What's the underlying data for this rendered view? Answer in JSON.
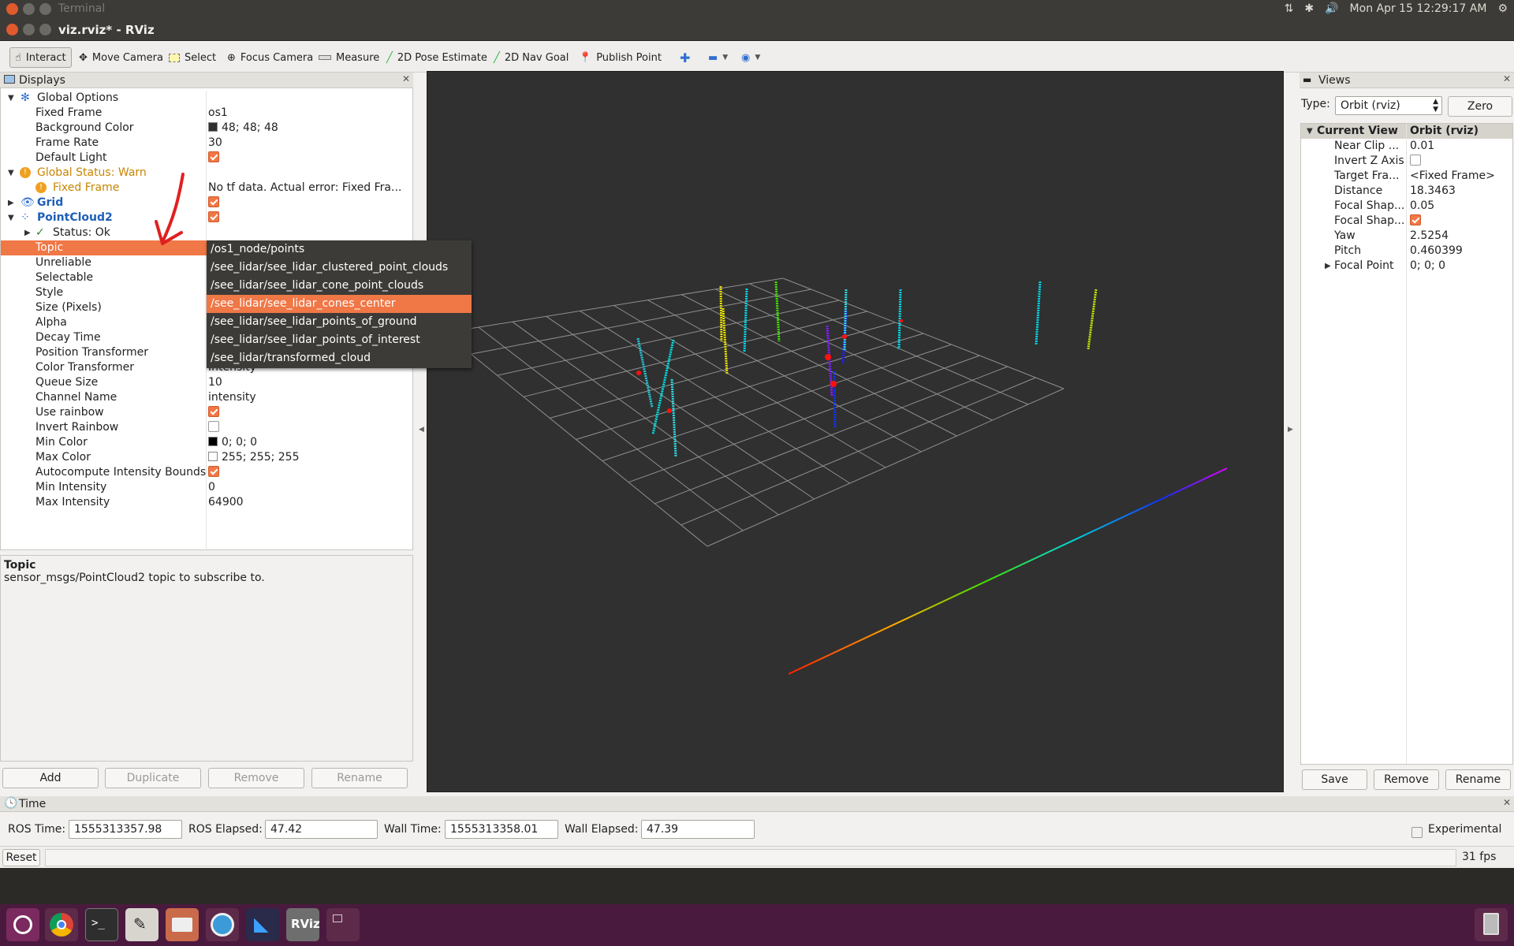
{
  "system_bar": {
    "title": "Terminal",
    "clock": "Mon Apr 15 12:29:17 AM"
  },
  "window": {
    "title": "viz.rviz* - RViz"
  },
  "toolbar": {
    "tools": [
      {
        "label": "Interact",
        "icon": "hand-icon"
      },
      {
        "label": "Move Camera",
        "icon": "move-camera-icon"
      },
      {
        "label": "Select",
        "icon": "select-icon"
      },
      {
        "label": "Focus Camera",
        "icon": "focus-camera-icon"
      },
      {
        "label": "Measure",
        "icon": "measure-icon"
      },
      {
        "label": "2D Pose Estimate",
        "icon": "pose-arrow-icon"
      },
      {
        "label": "2D Nav Goal",
        "icon": "nav-goal-icon"
      },
      {
        "label": "Publish Point",
        "icon": "pin-icon"
      }
    ]
  },
  "displays": {
    "title": "Displays",
    "rows": {
      "global_options": "Global Options",
      "fixed_frame": {
        "name": "Fixed Frame",
        "value": "os1"
      },
      "background_color": {
        "name": "Background Color",
        "value": "48; 48; 48",
        "swatch": "#303030"
      },
      "frame_rate": {
        "name": "Frame Rate",
        "value": "30"
      },
      "default_light": {
        "name": "Default Light"
      },
      "global_status": "Global Status: Warn",
      "fixed_frame_warn": {
        "name": "Fixed Frame",
        "value": "No tf data.  Actual error: Fixed Fra..."
      },
      "grid": "Grid",
      "pointcloud2": "PointCloud2",
      "status_ok": "Status: Ok",
      "topic": "Topic",
      "unreliable": "Unreliable",
      "selectable": "Selectable",
      "style": "Style",
      "size_pixels": "Size (Pixels)",
      "alpha": "Alpha",
      "decay_time": "Decay Time",
      "position_transformer": "Position Transformer",
      "color_transformer": {
        "name": "Color Transformer",
        "value": "Intensity"
      },
      "queue_size": {
        "name": "Queue Size",
        "value": "10"
      },
      "channel_name": {
        "name": "Channel Name",
        "value": "intensity"
      },
      "use_rainbow": {
        "name": "Use rainbow"
      },
      "invert_rainbow": {
        "name": "Invert Rainbow"
      },
      "min_color": {
        "name": "Min Color",
        "value": "0; 0; 0",
        "swatch": "#000000"
      },
      "max_color": {
        "name": "Max Color",
        "value": "255; 255; 255",
        "swatch": "#ffffff"
      },
      "autocompute": {
        "name": "Autocompute Intensity Bounds"
      },
      "min_intensity": {
        "name": "Min Intensity",
        "value": "0"
      },
      "max_intensity": {
        "name": "Max Intensity",
        "value": "64900"
      }
    },
    "topic_options": [
      "/os1_node/points",
      "/see_lidar/see_lidar_clustered_point_clouds",
      "/see_lidar/see_lidar_cone_point_clouds",
      "/see_lidar/see_lidar_cones_center",
      "/see_lidar/see_lidar_points_of_ground",
      "/see_lidar/see_lidar_points_of_interest",
      "/see_lidar/transformed_cloud"
    ],
    "selected_topic": "/see_lidar/see_lidar_cones_center",
    "description_title": "Topic",
    "description_text": "sensor_msgs/PointCloud2 topic to subscribe to.",
    "buttons": {
      "add": "Add",
      "duplicate": "Duplicate",
      "remove": "Remove",
      "rename": "Rename"
    }
  },
  "views": {
    "title": "Views",
    "type_label": "Type:",
    "type_value": "Orbit (rviz)",
    "zero": "Zero",
    "header": {
      "name": "Current View",
      "value": "Orbit (rviz)"
    },
    "rows": [
      {
        "name": "Near Clip ...",
        "value": "0.01"
      },
      {
        "name": "Invert Z Axis",
        "value": ""
      },
      {
        "name": "Target Fra...",
        "value": "<Fixed Frame>"
      },
      {
        "name": "Distance",
        "value": "18.3463"
      },
      {
        "name": "Focal Shap...",
        "value": "0.05"
      },
      {
        "name": "Focal Shap...",
        "value": ""
      },
      {
        "name": "Yaw",
        "value": "2.5254"
      },
      {
        "name": "Pitch",
        "value": "0.460399"
      },
      {
        "name": "Focal Point",
        "value": "0; 0; 0"
      }
    ],
    "buttons": {
      "save": "Save",
      "remove": "Remove",
      "rename": "Rename"
    }
  },
  "time": {
    "title": "Time",
    "ros_time_label": "ROS Time:",
    "ros_time": "1555313357.98",
    "ros_elapsed_label": "ROS Elapsed:",
    "ros_elapsed": "47.42",
    "wall_time_label": "Wall Time:",
    "wall_time": "1555313358.01",
    "wall_elapsed_label": "Wall Elapsed:",
    "wall_elapsed": "47.39",
    "experimental": "Experimental",
    "reset": "Reset",
    "fps": "31 fps"
  },
  "colors": {
    "accent": "#f07746",
    "viewport_bg": "#303030",
    "dock_bg": "#4a1a3e"
  }
}
